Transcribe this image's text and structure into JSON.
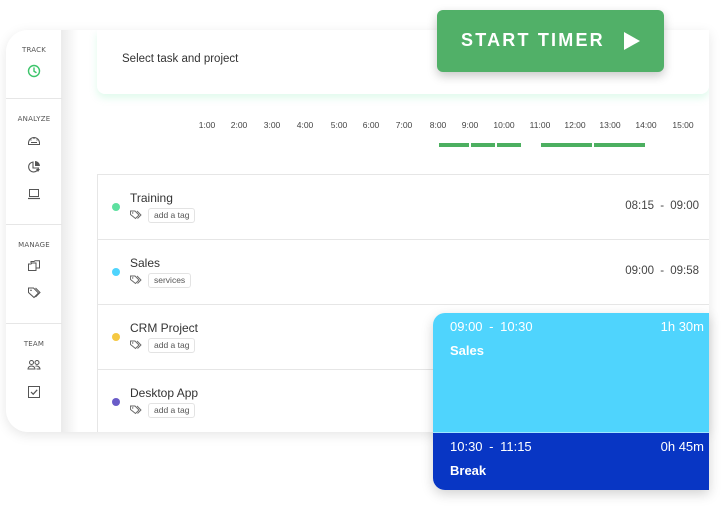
{
  "sidebar": {
    "sections": [
      {
        "label": "TRACK",
        "items": [
          {
            "icon": "clock-icon",
            "active": true
          }
        ]
      },
      {
        "label": "ANALYZE",
        "items": [
          {
            "icon": "dashboard-icon"
          },
          {
            "icon": "pie-chart-icon"
          },
          {
            "icon": "laptop-icon"
          }
        ]
      },
      {
        "label": "MANAGE",
        "items": [
          {
            "icon": "folder-icon"
          },
          {
            "icon": "tags-icon"
          }
        ]
      },
      {
        "label": "TEAM",
        "items": [
          {
            "icon": "team-icon"
          },
          {
            "icon": "checkbox-icon"
          }
        ]
      }
    ]
  },
  "task_bar": {
    "placeholder": "Select task and project"
  },
  "start_timer": {
    "label": "START TIMER",
    "icon": "play-icon"
  },
  "timeline": {
    "hours": [
      "1:00",
      "2:00",
      "3:00",
      "4:00",
      "5:00",
      "6:00",
      "7:00",
      "8:00",
      "9:00",
      "10:00",
      "11:00",
      "12:00",
      "13:00",
      "14:00",
      "15:00"
    ],
    "bar_color": "#4caf60",
    "segments": [
      {
        "start": "08:00",
        "end": "09:00"
      },
      {
        "start": "09:00",
        "end": "09:45"
      },
      {
        "start": "09:45",
        "end": "10:30"
      },
      {
        "start": "11:00",
        "end": "12:30"
      },
      {
        "start": "12:30",
        "end": "14:00"
      }
    ]
  },
  "tasks": [
    {
      "name": "Training",
      "color": "#5ee0a0",
      "tag": "add a tag",
      "start": "08:15",
      "end": "09:00"
    },
    {
      "name": "Sales",
      "color": "#4fd4fd",
      "tag": "services",
      "start": "09:00",
      "end": "09:58"
    },
    {
      "name": "CRM Project",
      "color": "#f5c842",
      "tag": "add a tag",
      "start": "",
      "end": ""
    },
    {
      "name": "Desktop App",
      "color": "#6a5cc8",
      "tag": "add a tag",
      "start": "",
      "end": ""
    }
  ],
  "entries": [
    {
      "start": "09:00",
      "end": "10:30",
      "range": "09:00 - 10:30",
      "duration": "1h 30m",
      "name": "Sales",
      "color": "#4fd4fd"
    },
    {
      "start": "10:30",
      "end": "11:15",
      "range": "10:30 - 11:15",
      "duration": "0h 45m",
      "name": "Break",
      "color": "#0836c4"
    }
  ]
}
